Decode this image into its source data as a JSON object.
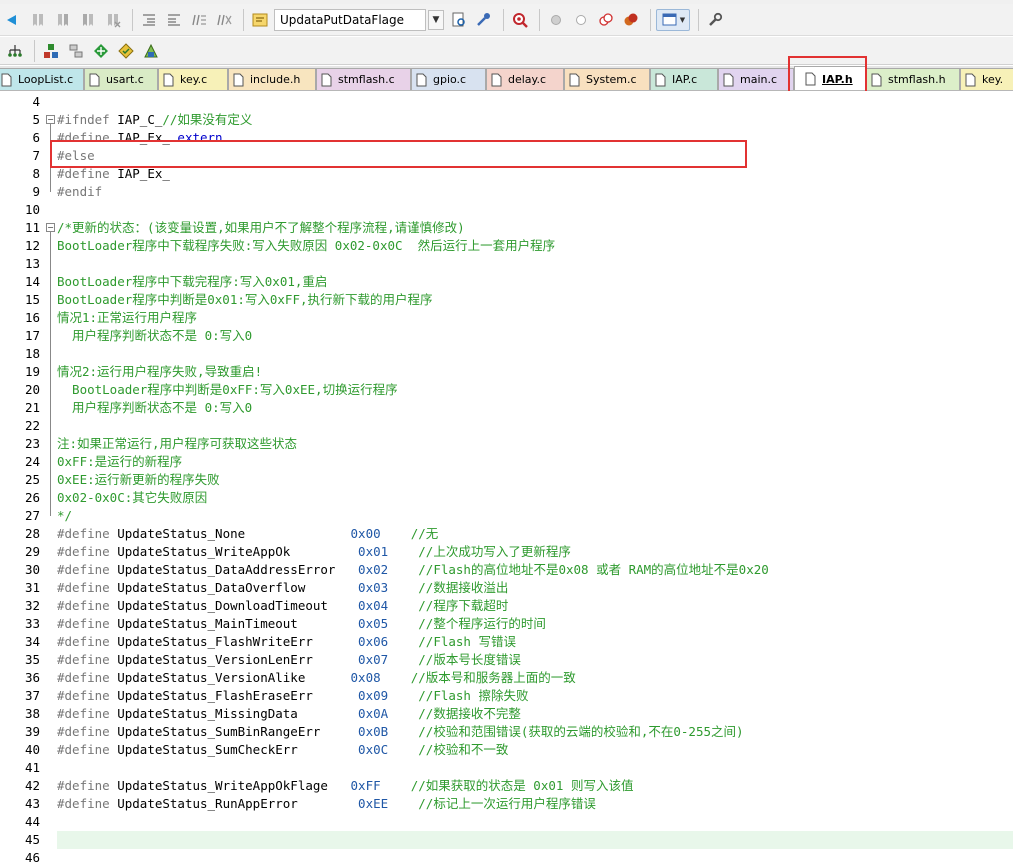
{
  "toolbar": {
    "target_name": "UpdataPutDataFlage"
  },
  "tabs": [
    {
      "label": "LoopList.c",
      "color": "#bfe6ea",
      "active": false
    },
    {
      "label": "usart.c",
      "color": "#d9ebc6",
      "active": false
    },
    {
      "label": "key.c",
      "color": "#f7f1b8",
      "active": false
    },
    {
      "label": "include.h",
      "color": "#f8e5bf",
      "active": false
    },
    {
      "label": "stmflash.c",
      "color": "#e8d2e8",
      "active": false
    },
    {
      "label": "gpio.c",
      "color": "#d8e2f0",
      "active": false
    },
    {
      "label": "delay.c",
      "color": "#f4d4cc",
      "active": false
    },
    {
      "label": "System.c",
      "color": "#f8e0bf",
      "active": false
    },
    {
      "label": "IAP.c",
      "color": "#c9e7d9",
      "active": false
    },
    {
      "label": "main.c",
      "color": "#e1d4ef",
      "active": false
    },
    {
      "label": "IAP.h",
      "color": "#ffffff",
      "active": true
    },
    {
      "label": "stmflash.h",
      "color": "#dcefc9",
      "active": false
    },
    {
      "label": "key.",
      "color": "#f7f1b8",
      "active": false
    }
  ],
  "editor": {
    "current_line": 45,
    "lines": [
      {
        "n": "4",
        "t": ""
      },
      {
        "n": "5",
        "t": "#ifndef IAP_C_//如果没有定义"
      },
      {
        "n": "6",
        "t": "#define IAP_Ex_ extern"
      },
      {
        "n": "7",
        "t": "#else"
      },
      {
        "n": "8",
        "t": "#define IAP_Ex_"
      },
      {
        "n": "9",
        "t": "#endif"
      },
      {
        "n": "10",
        "t": ""
      },
      {
        "n": "11",
        "t": "/*更新的状态：(该变量设置,如果用户不了解整个程序流程,请谨慎修改)"
      },
      {
        "n": "12",
        "t": "BootLoader程序中下载程序失败:写入失败原因 0x02-0x0C  然后运行上一套用户程序"
      },
      {
        "n": "13",
        "t": ""
      },
      {
        "n": "14",
        "t": "BootLoader程序中下载完程序:写入0x01,重启"
      },
      {
        "n": "15",
        "t": "BootLoader程序中判断是0x01:写入0xFF,执行新下载的用户程序"
      },
      {
        "n": "16",
        "t": "情况1:正常运行用户程序"
      },
      {
        "n": "17",
        "t": "  用户程序判断状态不是 0:写入0"
      },
      {
        "n": "18",
        "t": ""
      },
      {
        "n": "19",
        "t": "情况2:运行用户程序失败,导致重启!"
      },
      {
        "n": "20",
        "t": "  BootLoader程序中判断是0xFF:写入0xEE,切换运行程序"
      },
      {
        "n": "21",
        "t": "  用户程序判断状态不是 0:写入0"
      },
      {
        "n": "22",
        "t": ""
      },
      {
        "n": "23",
        "t": "注:如果正常运行,用户程序可获取这些状态"
      },
      {
        "n": "24",
        "t": "0xFF:是运行的新程序"
      },
      {
        "n": "25",
        "t": "0xEE:运行新更新的程序失败"
      },
      {
        "n": "26",
        "t": "0x02-0x0C:其它失败原因"
      },
      {
        "n": "27",
        "t": "*/"
      },
      {
        "n": "28",
        "t": "#define UpdateStatus_None              0x00    //无"
      },
      {
        "n": "29",
        "t": "#define UpdateStatus_WriteAppOk         0x01    //上次成功写入了更新程序"
      },
      {
        "n": "30",
        "t": "#define UpdateStatus_DataAddressError   0x02    //Flash的高位地址不是0x08 或者 RAM的高位地址不是0x20"
      },
      {
        "n": "31",
        "t": "#define UpdateStatus_DataOverflow       0x03    //数据接收溢出"
      },
      {
        "n": "32",
        "t": "#define UpdateStatus_DownloadTimeout    0x04    //程序下载超时"
      },
      {
        "n": "33",
        "t": "#define UpdateStatus_MainTimeout        0x05    //整个程序运行的时间"
      },
      {
        "n": "34",
        "t": "#define UpdateStatus_FlashWriteErr      0x06    //Flash 写错误"
      },
      {
        "n": "35",
        "t": "#define UpdateStatus_VersionLenErr      0x07    //版本号长度错误"
      },
      {
        "n": "36",
        "t": "#define UpdateStatus_VersionAlike      0x08    //版本号和服务器上面的一致"
      },
      {
        "n": "37",
        "t": "#define UpdateStatus_FlashEraseErr      0x09    //Flash 擦除失败"
      },
      {
        "n": "38",
        "t": "#define UpdateStatus_MissingData        0x0A    //数据接收不完整"
      },
      {
        "n": "39",
        "t": "#define UpdateStatus_SumBinRangeErr     0x0B    //校验和范围错误(获取的云端的校验和,不在0-255之间)"
      },
      {
        "n": "40",
        "t": "#define UpdateStatus_SumCheckErr        0x0C    //校验和不一致"
      },
      {
        "n": "41",
        "t": ""
      },
      {
        "n": "42",
        "t": "#define UpdateStatus_WriteAppOkFlage   0xFF    //如果获取的状态是 0x01 则写入该值"
      },
      {
        "n": "43",
        "t": "#define UpdateStatus_RunAppError        0xEE    //标记上一次运行用户程序错误"
      },
      {
        "n": "44",
        "t": ""
      },
      {
        "n": "45",
        "t": ""
      },
      {
        "n": "46",
        "t": ""
      }
    ]
  }
}
